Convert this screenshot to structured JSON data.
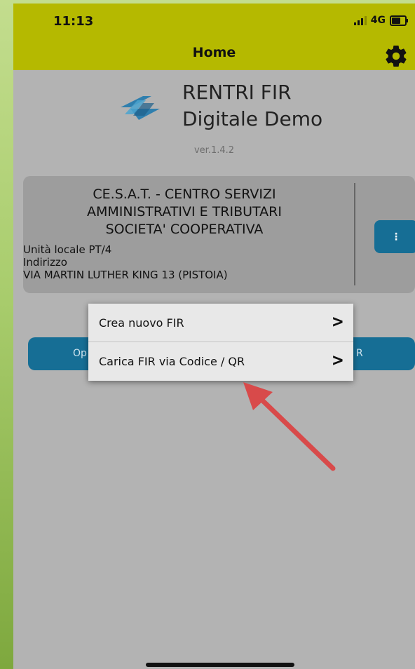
{
  "status_bar": {
    "time": "11:13",
    "network": "4G"
  },
  "header": {
    "title": "Home"
  },
  "app": {
    "name_line1": "RENTRI FIR",
    "name_line2": "Digitale Demo",
    "version": "ver.1.4.2"
  },
  "company_card": {
    "name_line1": "CE.S.A.T. - CENTRO SERVIZI",
    "name_line2": "AMMINISTRATIVI E TRIBUTARI",
    "name_line3": "SOCIETA' COOPERATIVA",
    "unit_line": "Unità locale PT/4",
    "address_label": "Indirizzo",
    "address_value": "VIA MARTIN LUTHER KING 13 (PISTOIA)",
    "menu_button_glyph": "⋮"
  },
  "buttons_behind": {
    "left_fragment": "Op",
    "right_fragment": "R"
  },
  "popup_menu": {
    "items": [
      {
        "label": "Crea nuovo FIR",
        "chevron": ">"
      },
      {
        "label": "Carica FIR via Codice / QR",
        "chevron": ">"
      }
    ]
  },
  "annotation": {
    "color": "#d84a4a"
  },
  "colors": {
    "topbar": "#b5b900",
    "primary": "#166e95",
    "background": "#b3b3b3"
  },
  "icons": {
    "settings": "gear-icon",
    "logo": "rentri-logo",
    "signal": "signal-icon",
    "battery": "battery-icon"
  }
}
